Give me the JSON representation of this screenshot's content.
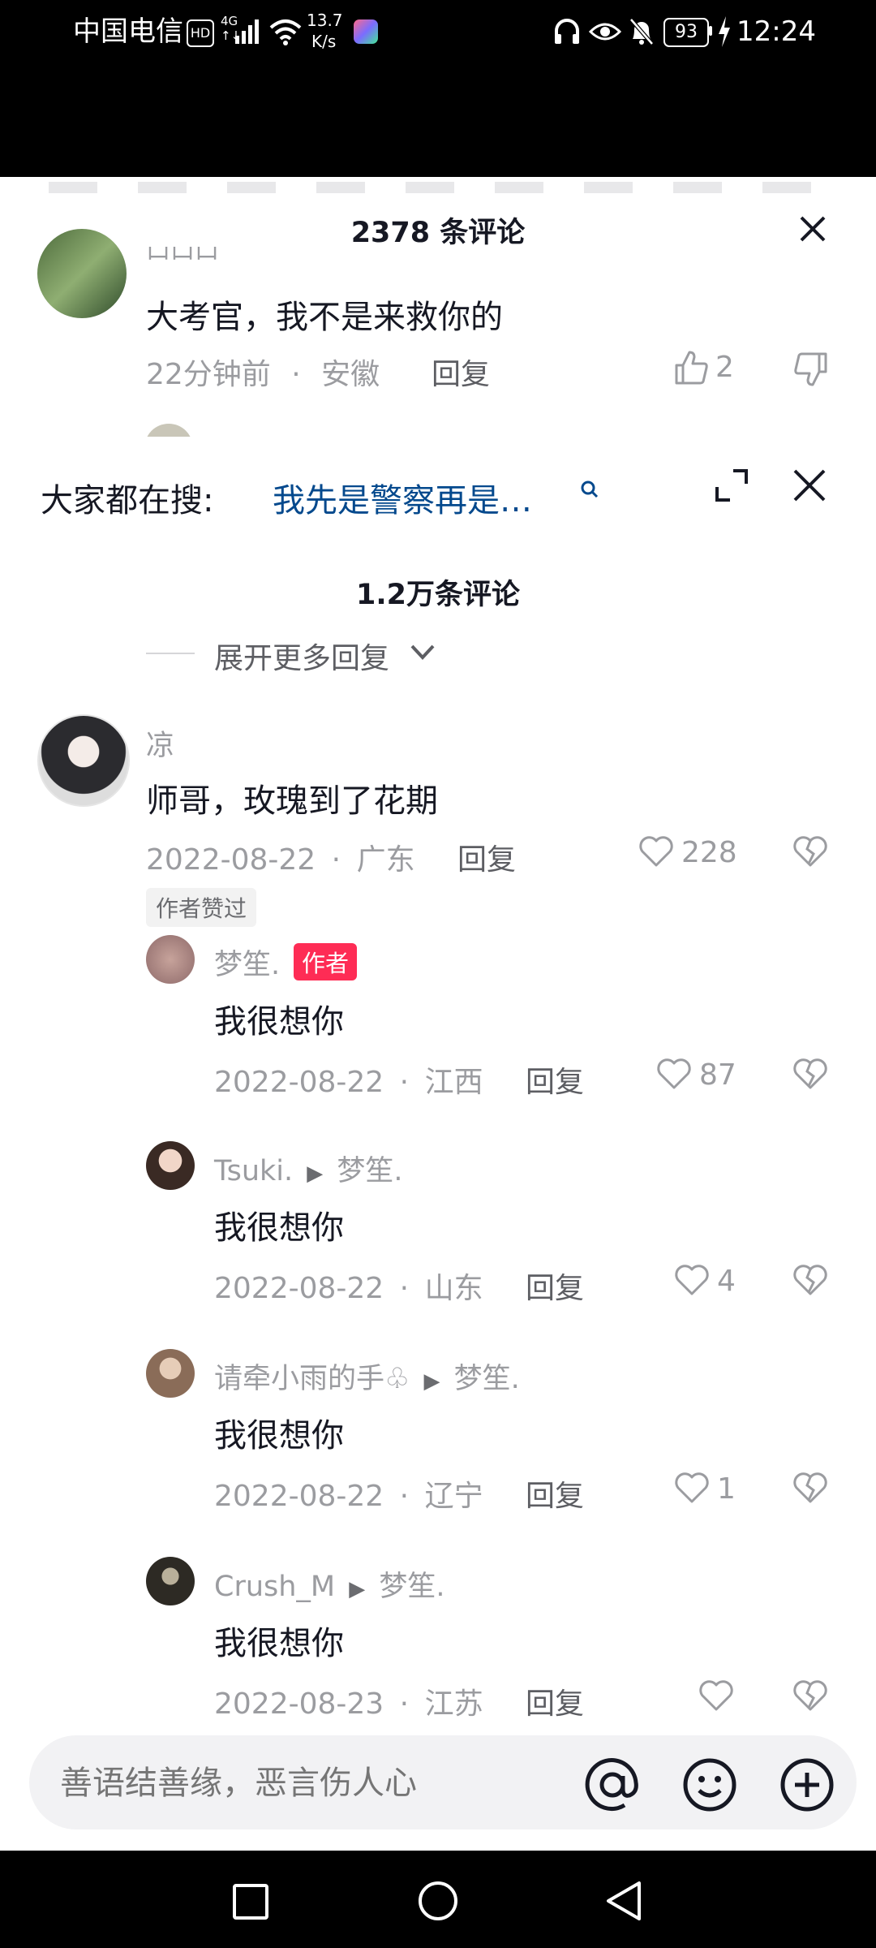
{
  "status_bar": {
    "carrier": "中国电信",
    "hd": "HD",
    "network_top": "4G",
    "network_bottom": "↑↓",
    "speed_value": "13.7",
    "speed_unit": "K/s",
    "battery": "93",
    "time": "12:24"
  },
  "sheet_behind": {
    "header_title": "2378 条评论",
    "truncated_username": "口口口",
    "comment_text": "大考官，我不是来救你的",
    "time": "22分钟前",
    "dot": "·",
    "location": "安徽",
    "reply_label": "回复",
    "like_count": "2"
  },
  "search_bar": {
    "label": "大家都在搜:",
    "query": "我先是警察再是…"
  },
  "main": {
    "header_title": "1.2万条评论",
    "expand_more": "展开更多回复",
    "comment": {
      "username": "凉",
      "text": "师哥，玫瑰到了花期",
      "date": "2022-08-22",
      "dot": "·",
      "location": "广东",
      "reply_label": "回复",
      "like_count": "228",
      "author_liked_tag": "作者赞过"
    },
    "replies": [
      {
        "username": "梦笙.",
        "badge": "作者",
        "reply_to": "",
        "text": "我很想你",
        "date": "2022-08-22",
        "dot": "·",
        "location": "江西",
        "reply_label": "回复",
        "like_count": "87"
      },
      {
        "username": "Tsuki.",
        "badge": "",
        "reply_to": "梦笙.",
        "text": "我很想你",
        "date": "2022-08-22",
        "dot": "·",
        "location": "山东",
        "reply_label": "回复",
        "like_count": "4"
      },
      {
        "username": "请牵小雨的手♧",
        "badge": "",
        "reply_to": "梦笙.",
        "text": "我很想你",
        "date": "2022-08-22",
        "dot": "·",
        "location": "辽宁",
        "reply_label": "回复",
        "like_count": "1"
      },
      {
        "username": "Crush_M",
        "badge": "",
        "reply_to": "梦笙.",
        "text": "我很想你",
        "date": "2022-08-23",
        "dot": "·",
        "location": "江苏",
        "reply_label": "回复",
        "like_count": ""
      }
    ]
  },
  "input": {
    "placeholder": "善语结善缘，恶言伤人心"
  },
  "icons": {
    "close": "close-icon",
    "expand": "expand-icon",
    "search": "search-icon",
    "like": "heart-icon",
    "dislike": "broken-heart-icon",
    "mention": "at-icon",
    "emoji": "emoji-icon",
    "add": "plus-circle-icon"
  }
}
